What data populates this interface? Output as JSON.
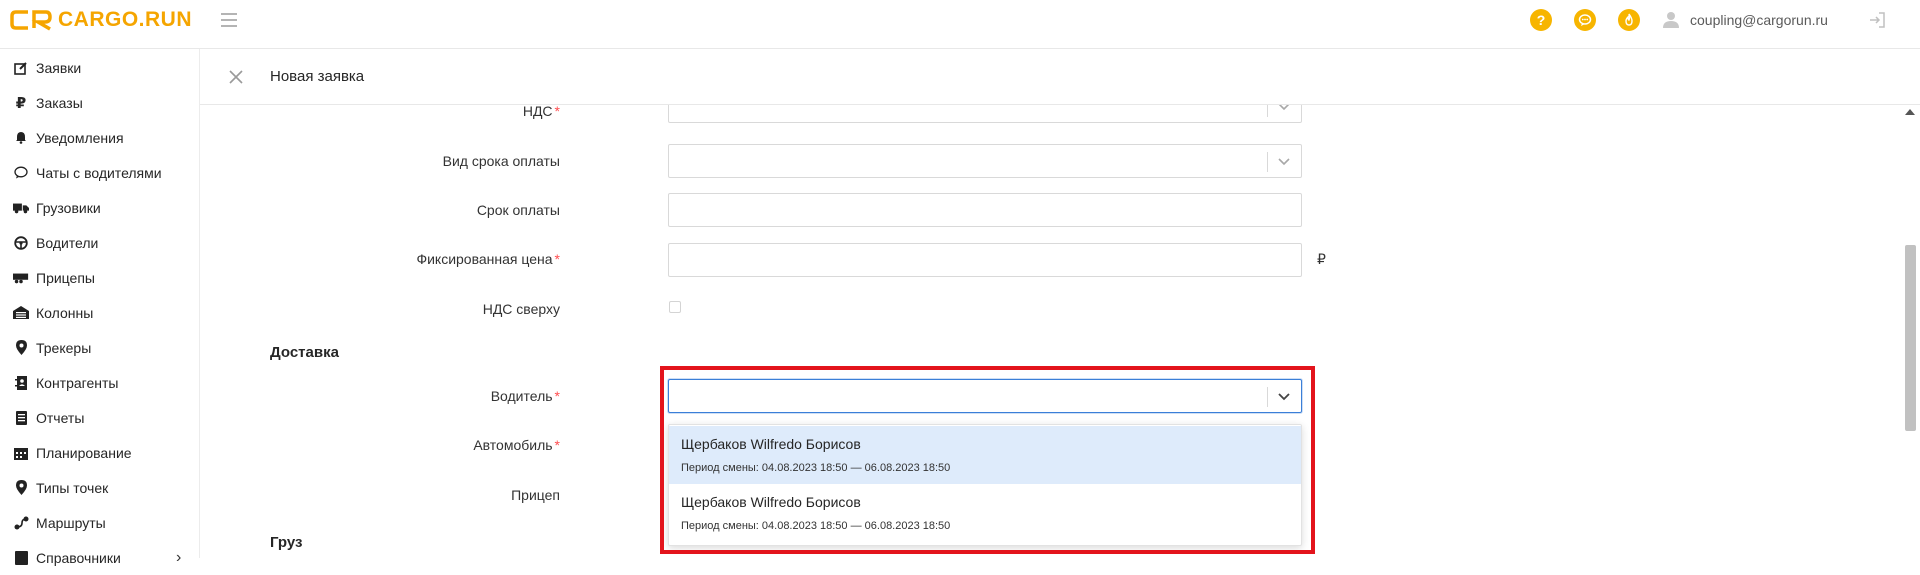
{
  "app": {
    "logo_text": "CARGO.RUN",
    "user_email": "coupling@cargorun.ru",
    "brand_color": "#f5a500",
    "icons": [
      "help-icon",
      "chat-icon",
      "fire-icon"
    ]
  },
  "sidebar": {
    "items": [
      {
        "label": "Заявки",
        "icon": "edit-icon"
      },
      {
        "label": "Заказы",
        "icon": "ruble-icon"
      },
      {
        "label": "Уведомления",
        "icon": "bell-icon"
      },
      {
        "label": "Чаты с водителями",
        "icon": "chat-bubble-icon"
      },
      {
        "label": "Грузовики",
        "icon": "truck-icon"
      },
      {
        "label": "Водители",
        "icon": "steering-wheel-icon"
      },
      {
        "label": "Прицепы",
        "icon": "trailer-icon"
      },
      {
        "label": "Колонны",
        "icon": "garage-icon"
      },
      {
        "label": "Трекеры",
        "icon": "map-pin-icon"
      },
      {
        "label": "Контрагенты",
        "icon": "contacts-icon"
      },
      {
        "label": "Отчеты",
        "icon": "report-icon"
      },
      {
        "label": "Планирование",
        "icon": "calendar-icon"
      },
      {
        "label": "Типы точек",
        "icon": "map-pin-icon"
      },
      {
        "label": "Маршруты",
        "icon": "route-icon"
      },
      {
        "label": "Справочники",
        "icon": "book-icon"
      }
    ]
  },
  "page": {
    "title": "Новая заявка"
  },
  "form": {
    "nds_label": "НДС",
    "payment_term_type_label": "Вид срока оплаты",
    "payment_term_label": "Срок оплаты",
    "fixed_price_label": "Фиксированная цена",
    "currency_symbol": "₽",
    "nds_on_top_label": "НДС сверху",
    "delivery_section": "Доставка",
    "driver_label": "Водитель",
    "vehicle_label": "Автомобиль",
    "trailer_label": "Прицеп",
    "cargo_section": "Груз",
    "required_mark": "*"
  },
  "driver_dropdown": {
    "options": [
      {
        "name": "Щербаков Wilfredo Борисов",
        "period": "Период смены: 04.08.2023 18:50 — 06.08.2023 18:50",
        "highlighted": true
      },
      {
        "name": "Щербаков Wilfredo Борисов",
        "period": "Период смены: 04.08.2023 18:50 — 06.08.2023 18:50",
        "highlighted": false
      }
    ]
  }
}
